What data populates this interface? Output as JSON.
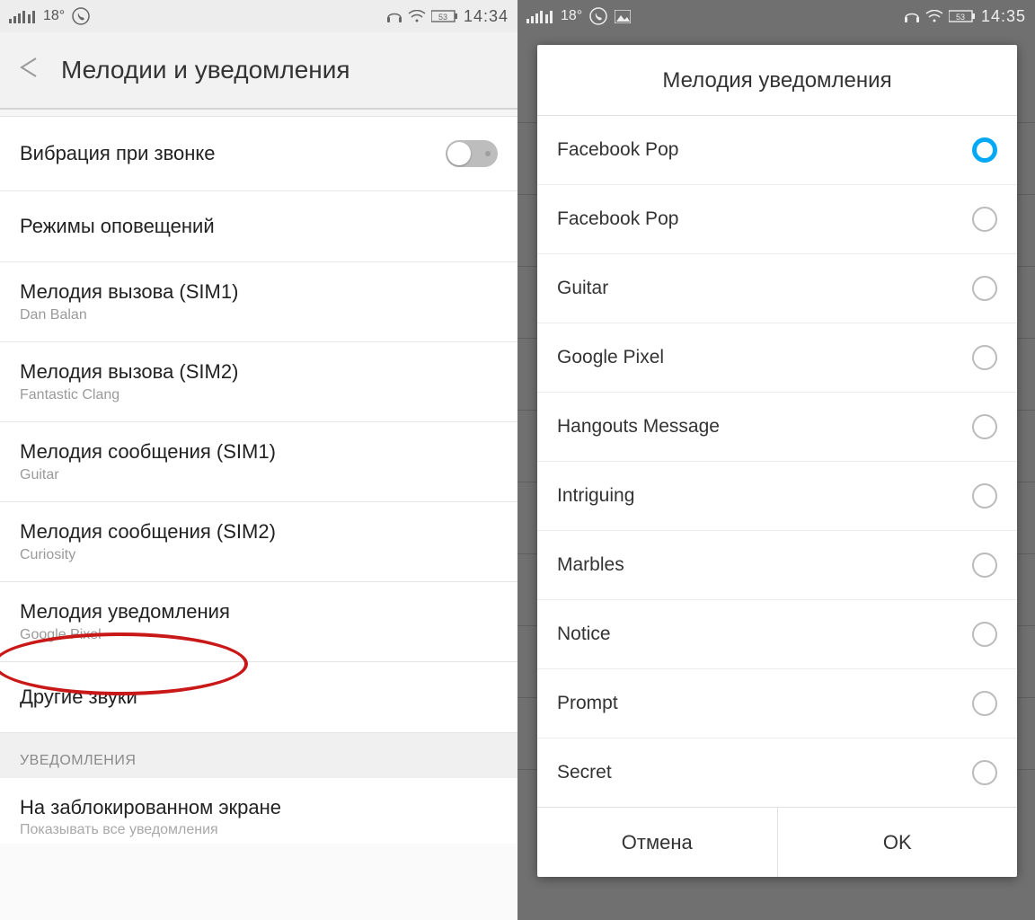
{
  "statusbar_left": {
    "temp": "18°",
    "time": "14:34"
  },
  "statusbar_right": {
    "temp": "18°",
    "time": "14:35"
  },
  "battery": "53",
  "header": {
    "title": "Мелодии и уведомления"
  },
  "items": {
    "vibrate": "Вибрация при звонке",
    "modes": "Режимы оповещений",
    "ring_sim1_title": "Мелодия вызова (SIM1)",
    "ring_sim1_sub": "Dan Balan",
    "ring_sim2_title": "Мелодия вызова (SIM2)",
    "ring_sim2_sub": "Fantastic Clang",
    "msg_sim1_title": "Мелодия сообщения (SIM1)",
    "msg_sim1_sub": "Guitar",
    "msg_sim2_title": "Мелодия сообщения (SIM2)",
    "msg_sim2_sub": "Curiosity",
    "notif_title": "Мелодия уведомления",
    "notif_sub": "Google Pixel",
    "other": "Другие звуки",
    "section": "УВЕДОМЛЕНИЯ",
    "lock_title": "На заблокированном экране",
    "lock_sub": "Показывать все уведомления"
  },
  "dialog": {
    "title": "Мелодия уведомления",
    "options": {
      "o0": "Facebook Pop",
      "o1": "Facebook Pop",
      "o2": "Guitar",
      "o3": "Google Pixel",
      "o4": "Hangouts Message",
      "o5": "Intriguing",
      "o6": "Marbles",
      "o7": "Notice",
      "o8": "Prompt",
      "o9": "Secret"
    },
    "cancel": "Отмена",
    "ok": "OK"
  }
}
